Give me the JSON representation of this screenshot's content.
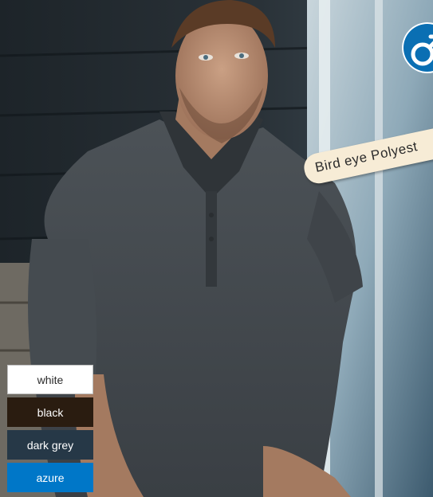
{
  "image": {
    "alt": "Man wearing dark grey polo shirt sitting outdoors",
    "subject": "model-in-polo-shirt"
  },
  "gender_badge": {
    "icon": "male-symbol-icon",
    "color": "#0a6fb3"
  },
  "fabric_tag": {
    "label": "Bird eye Polyest"
  },
  "colors": [
    {
      "label": "white",
      "hex": "#ffffff"
    },
    {
      "label": "black",
      "hex": "#2a1c10"
    },
    {
      "label": "dark grey",
      "hex": "#263847"
    },
    {
      "label": "azure",
      "hex": "#0077c8"
    }
  ]
}
